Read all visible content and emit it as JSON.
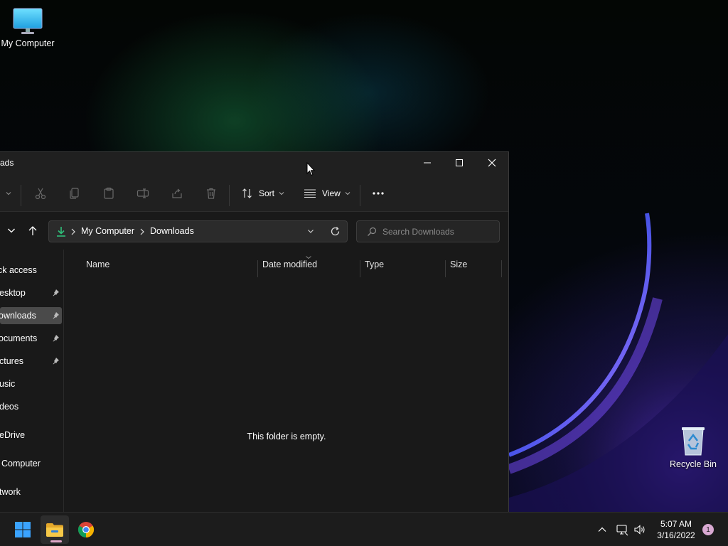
{
  "desktop": {
    "icons": [
      {
        "label": "My Computer",
        "icon": "monitor-icon"
      },
      {
        "label": "Recycle Bin",
        "icon": "recycle-bin-icon"
      }
    ]
  },
  "window": {
    "title": "ads",
    "controls": {
      "minimize": "minimize-icon",
      "maximize": "maximize-icon",
      "close": "close-icon"
    }
  },
  "toolbar": {
    "icons": [
      "cut-icon",
      "copy-icon",
      "paste-icon",
      "rename-icon",
      "share-icon",
      "delete-icon"
    ],
    "sort_label": "Sort",
    "view_label": "View",
    "more_icon": "more-icon"
  },
  "navigation": {
    "path": [
      "My Computer",
      "Downloads"
    ],
    "search_placeholder": "Search Downloads"
  },
  "sidebar": {
    "items": [
      {
        "label": "ck access",
        "pinned": false,
        "selected": false
      },
      {
        "label": "esktop",
        "pinned": true,
        "selected": false
      },
      {
        "label": "ownloads",
        "pinned": true,
        "selected": true
      },
      {
        "label": "ocuments",
        "pinned": true,
        "selected": false
      },
      {
        "label": "ctures",
        "pinned": true,
        "selected": false
      },
      {
        "label": "usic",
        "pinned": false,
        "selected": false
      },
      {
        "label": "deos",
        "pinned": false,
        "selected": false
      },
      {
        "label": "eDrive",
        "pinned": false,
        "selected": false
      },
      {
        "label": "Computer",
        "pinned": false,
        "selected": false
      },
      {
        "label": "twork",
        "pinned": false,
        "selected": false
      }
    ]
  },
  "content": {
    "columns": [
      "Name",
      "Date modified",
      "Type",
      "Size"
    ],
    "empty_message": "This folder is empty."
  },
  "taskbar": {
    "apps": [
      "windows-start-icon",
      "file-explorer-icon",
      "chrome-icon"
    ],
    "clock_time": "5:07 AM",
    "clock_date": "3/16/2022",
    "notification_count": "1"
  },
  "colors": {
    "accent": "#0078d4",
    "window_bg": "#191919",
    "titlebar_bg": "#202020",
    "selected_bg": "#4a4a4a",
    "download_green": "#2fc07a",
    "badge": "#d9a9d2"
  }
}
